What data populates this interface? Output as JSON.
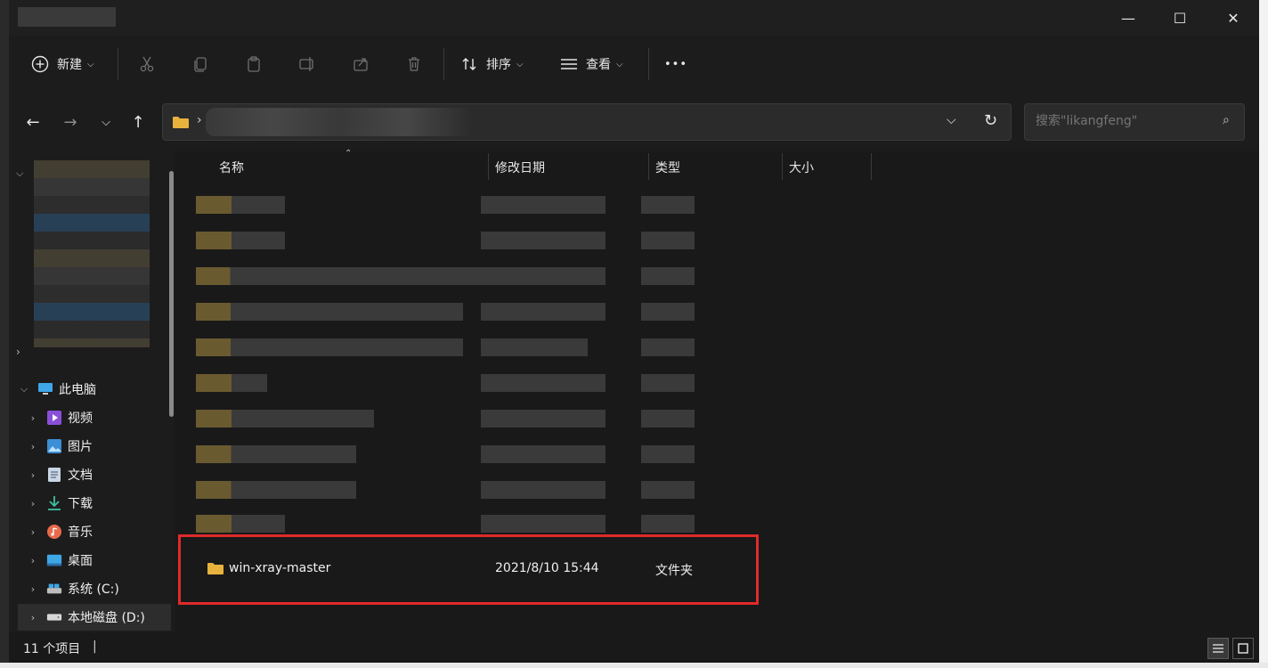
{
  "window": {
    "minimize_glyph": "—",
    "maximize_glyph": "☐",
    "close_glyph": "✕"
  },
  "toolbar": {
    "new_label": "新建",
    "sort_label": "排序",
    "view_label": "查看",
    "more_glyph": "•••"
  },
  "address": {
    "path_sep": "›"
  },
  "search": {
    "placeholder": "搜索\"likangfeng\""
  },
  "columns": {
    "name": "名称",
    "modified": "修改日期",
    "type": "类型",
    "size": "大小"
  },
  "sidebar": {
    "this_pc": "此电脑",
    "items": [
      {
        "label": "视频",
        "icon": "video-folder-icon"
      },
      {
        "label": "图片",
        "icon": "pictures-folder-icon"
      },
      {
        "label": "文档",
        "icon": "documents-folder-icon"
      },
      {
        "label": "下载",
        "icon": "downloads-folder-icon"
      },
      {
        "label": "音乐",
        "icon": "music-folder-icon"
      },
      {
        "label": "桌面",
        "icon": "desktop-folder-icon"
      },
      {
        "label": "系统 (C:)",
        "icon": "drive-c-icon"
      },
      {
        "label": "本地磁盘 (D:)",
        "icon": "drive-d-icon"
      }
    ]
  },
  "files": [
    {
      "name": "win-xray-master",
      "modified": "2021/8/10 15:44",
      "type": "文件夹",
      "size": ""
    }
  ],
  "status": {
    "count": "11 个项目",
    "cursor": "|"
  },
  "colors": {
    "highlight": "#e02a2a",
    "folder": "#e8b33c"
  }
}
